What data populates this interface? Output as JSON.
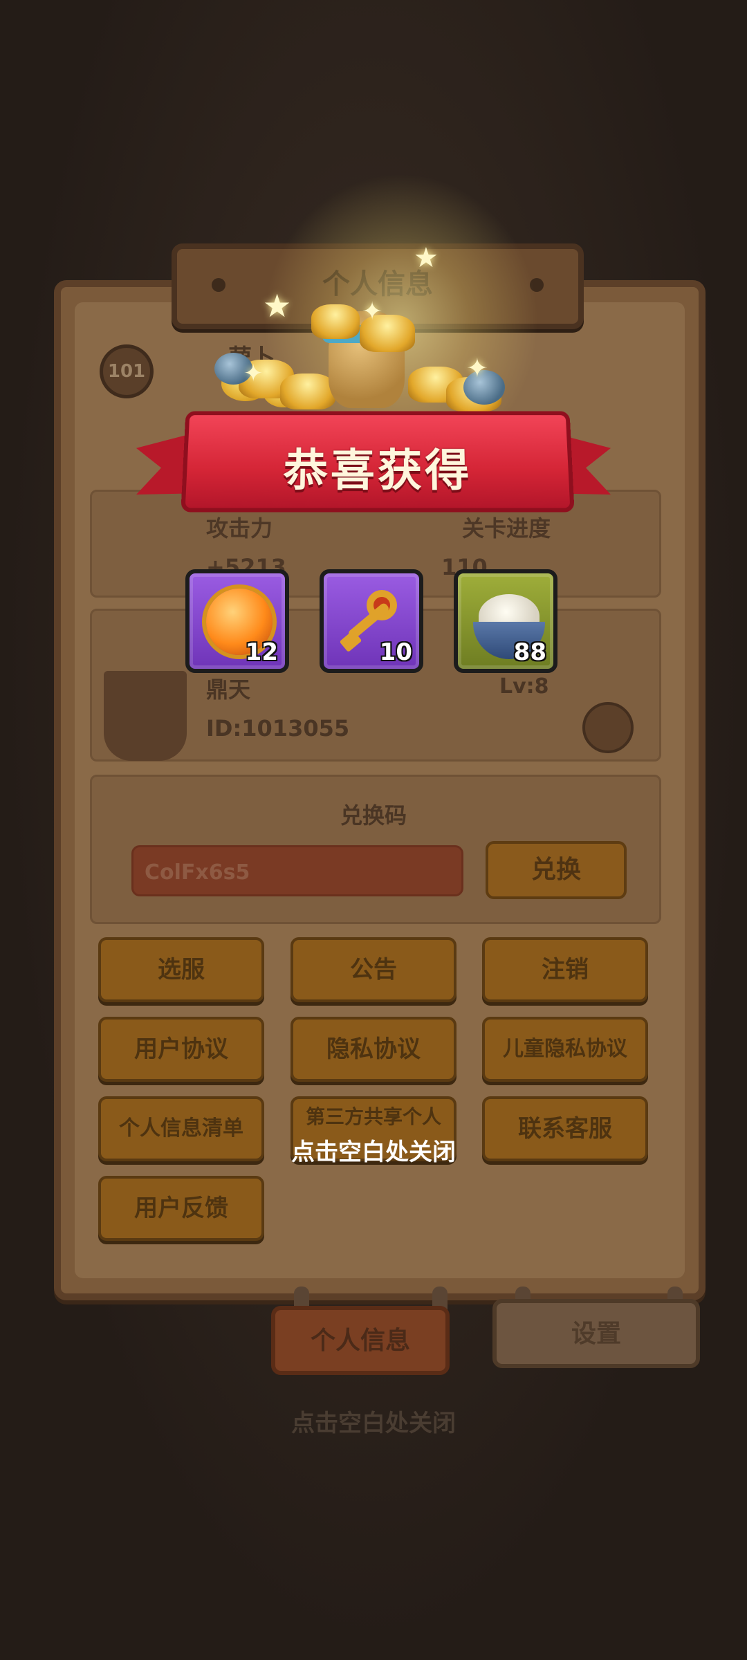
{
  "background": {
    "header_title": "个人信息",
    "player": {
      "level": "101",
      "name": "萝卜"
    },
    "stats": {
      "attack_label": "攻击力",
      "attack_value": "+5213",
      "stage_label": "关卡进度",
      "stage_value": "110"
    },
    "guild": {
      "name": "鼎天",
      "id": "ID:1013055",
      "level": "Lv:8"
    },
    "redeem": {
      "title": "兑换码",
      "input_value": "ColFx6s5",
      "button": "兑换"
    },
    "menu_buttons": [
      "选服",
      "公告",
      "注销",
      "用户协议",
      "隐私协议",
      "儿童隐私协议",
      "个人信息清单",
      "第三方共享个人",
      "联系客服",
      "用户反馈"
    ],
    "tabs": {
      "active": "个人信息",
      "inactive": "设置"
    },
    "close_hint": "点击空白处关闭"
  },
  "popup": {
    "title": "恭喜获得",
    "rewards": [
      {
        "icon": "dragon-orb-icon",
        "count": "12",
        "rarity": "purple"
      },
      {
        "icon": "key-icon",
        "count": "10",
        "rarity": "purple"
      },
      {
        "icon": "rice-bowl-icon",
        "count": "88",
        "rarity": "green"
      }
    ],
    "close_hint": "点击空白处关闭"
  },
  "colors": {
    "ribbon_red": "#d42536",
    "purple_frame": "#8a4dd6",
    "green_frame": "#8a9a30"
  }
}
